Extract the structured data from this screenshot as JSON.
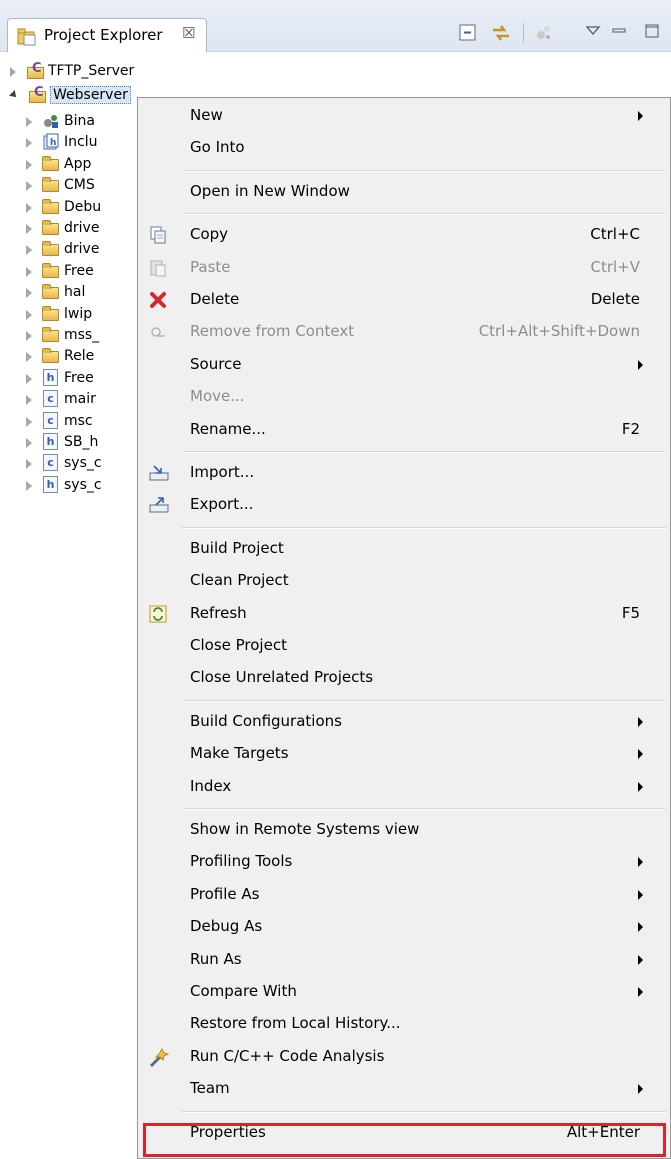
{
  "view": {
    "title": "Project Explorer",
    "close_glyph": "☒",
    "toolbar_icons": [
      "collapse-all-icon",
      "link-with-editor-icon",
      "filter-icon",
      "view-menu-icon",
      "minimize-icon",
      "maximize-icon"
    ]
  },
  "tree": {
    "projects": [
      {
        "label": "TFTP_Server",
        "expanded": false
      },
      {
        "label": "Webserver",
        "expanded": true,
        "selected": true
      }
    ],
    "children": [
      {
        "label": "Bina",
        "icon": "binaries-icon"
      },
      {
        "label": "Inclu",
        "icon": "includes-icon"
      },
      {
        "label": "App",
        "icon": "folder-icon"
      },
      {
        "label": "CMS",
        "icon": "folder-icon"
      },
      {
        "label": "Debu",
        "icon": "folder-icon"
      },
      {
        "label": "drive",
        "icon": "folder-icon"
      },
      {
        "label": "drive",
        "icon": "folder-icon"
      },
      {
        "label": "Free",
        "icon": "folder-icon"
      },
      {
        "label": "hal",
        "icon": "folder-icon"
      },
      {
        "label": "lwip",
        "icon": "folder-icon"
      },
      {
        "label": "mss_",
        "icon": "folder-icon"
      },
      {
        "label": "Rele",
        "icon": "folder-icon"
      },
      {
        "label": "Free",
        "icon": "h-file-icon",
        "glyph": "h"
      },
      {
        "label": "mair",
        "icon": "c-file-icon",
        "glyph": "c"
      },
      {
        "label": "msc",
        "icon": "c-file-icon",
        "glyph": "c"
      },
      {
        "label": "SB_h",
        "icon": "h-file-icon",
        "glyph": "h"
      },
      {
        "label": "sys_c",
        "icon": "c-file-icon",
        "glyph": "c"
      },
      {
        "label": "sys_c",
        "icon": "h-file-icon",
        "glyph": "h"
      }
    ]
  },
  "menu": {
    "items": [
      {
        "label": "New",
        "submenu": true
      },
      {
        "label": "Go Into"
      },
      {
        "sep": true
      },
      {
        "label": "Open in New Window"
      },
      {
        "sep": true
      },
      {
        "label": "Copy",
        "shortcut": "Ctrl+C",
        "icon": "copy-icon"
      },
      {
        "label": "Paste",
        "shortcut": "Ctrl+V",
        "icon": "paste-icon",
        "disabled": true
      },
      {
        "label": "Delete",
        "shortcut": "Delete",
        "icon": "delete-icon"
      },
      {
        "label": "Remove from Context",
        "shortcut": "Ctrl+Alt+Shift+Down",
        "icon": "remove-context-icon",
        "disabled": true
      },
      {
        "label": "Source",
        "submenu": true
      },
      {
        "label": "Move...",
        "disabled": true
      },
      {
        "label": "Rename...",
        "shortcut": "F2"
      },
      {
        "sep": true
      },
      {
        "label": "Import...",
        "icon": "import-icon"
      },
      {
        "label": "Export...",
        "icon": "export-icon"
      },
      {
        "sep": true
      },
      {
        "label": "Build Project"
      },
      {
        "label": "Clean Project"
      },
      {
        "label": "Refresh",
        "shortcut": "F5",
        "icon": "refresh-icon"
      },
      {
        "label": "Close Project"
      },
      {
        "label": "Close Unrelated Projects"
      },
      {
        "sep": true
      },
      {
        "label": "Build Configurations",
        "submenu": true
      },
      {
        "label": "Make Targets",
        "submenu": true
      },
      {
        "label": "Index",
        "submenu": true
      },
      {
        "sep": true
      },
      {
        "label": "Show in Remote Systems view"
      },
      {
        "label": "Profiling Tools",
        "submenu": true
      },
      {
        "label": "Profile As",
        "submenu": true
      },
      {
        "label": "Debug As",
        "submenu": true
      },
      {
        "label": "Run As",
        "submenu": true
      },
      {
        "label": "Compare With",
        "submenu": true
      },
      {
        "label": "Restore from Local History..."
      },
      {
        "label": "Run C/C++ Code Analysis",
        "icon": "code-analysis-icon"
      },
      {
        "label": "Team",
        "submenu": true
      },
      {
        "sep": true
      },
      {
        "label": "Properties",
        "shortcut": "Alt+Enter",
        "highlighted": true
      }
    ]
  },
  "colors": {
    "highlight_border": "#e0202c",
    "selection_bg": "#d6e6f7",
    "menu_bg": "#f0f0f0"
  }
}
